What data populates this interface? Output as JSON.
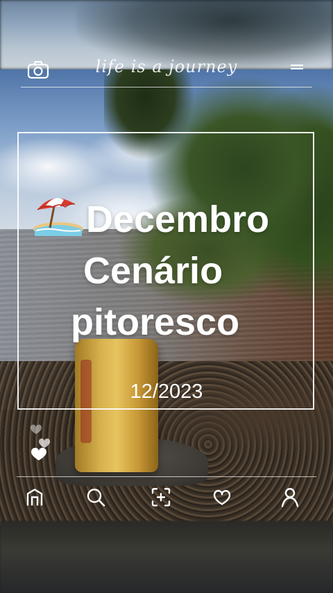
{
  "top_bar": {
    "title": "life is a journey",
    "left_icon": "camera-icon",
    "right_icon": "stack-icon"
  },
  "post": {
    "emoji": "beach-umbrella-emoji",
    "headline": [
      "Decembro",
      "Cenário",
      "pitoresco"
    ],
    "date": "12/2023"
  },
  "reactions": {
    "icon": "hearts-icon"
  },
  "bottom_nav": {
    "items": [
      {
        "icon": "home-icon"
      },
      {
        "icon": "search-icon"
      },
      {
        "icon": "add-photo-icon"
      },
      {
        "icon": "heart-icon"
      },
      {
        "icon": "profile-icon"
      }
    ]
  },
  "colors": {
    "overlay_text": "#ffffff",
    "frame": "#ffffff"
  }
}
